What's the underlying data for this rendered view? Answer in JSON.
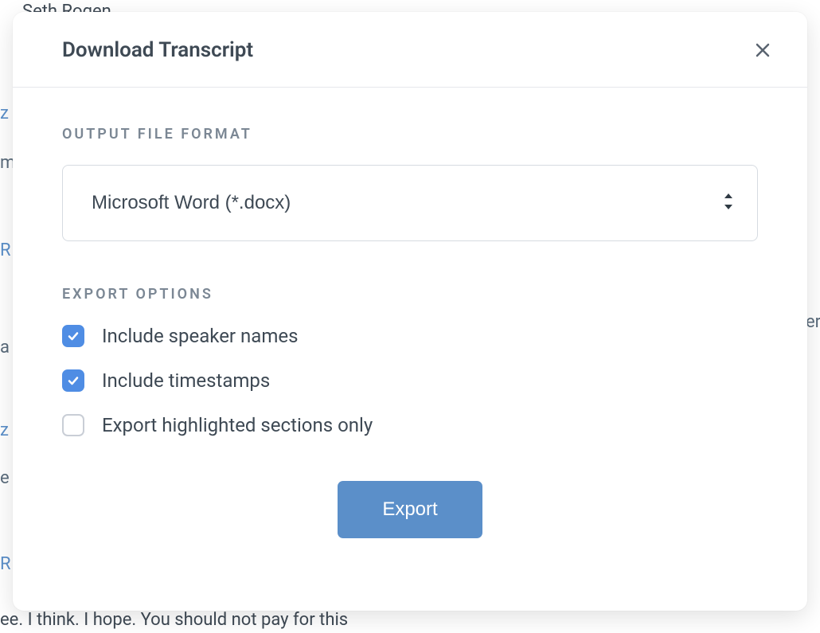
{
  "background": {
    "line1": "Seth Rogen",
    "line2_prefix": "z",
    "line3_prefix": "m",
    "line3_suffix": "er",
    "line4_prefix": "R",
    "line5": "a",
    "line6_prefix": "z",
    "line7_prefix": "e",
    "line8_prefix": "R",
    "bottom": "ee. I think. I hope. You should not pay for this"
  },
  "modal": {
    "title": "Download Transcript",
    "output_format_label": "OUTPUT FILE FORMAT",
    "selected_format": "Microsoft Word (*.docx)",
    "export_options_label": "EXPORT OPTIONS",
    "options": [
      {
        "label": "Include speaker names",
        "checked": true
      },
      {
        "label": "Include timestamps",
        "checked": true
      },
      {
        "label": "Export highlighted sections only",
        "checked": false
      }
    ],
    "export_button": "Export"
  }
}
